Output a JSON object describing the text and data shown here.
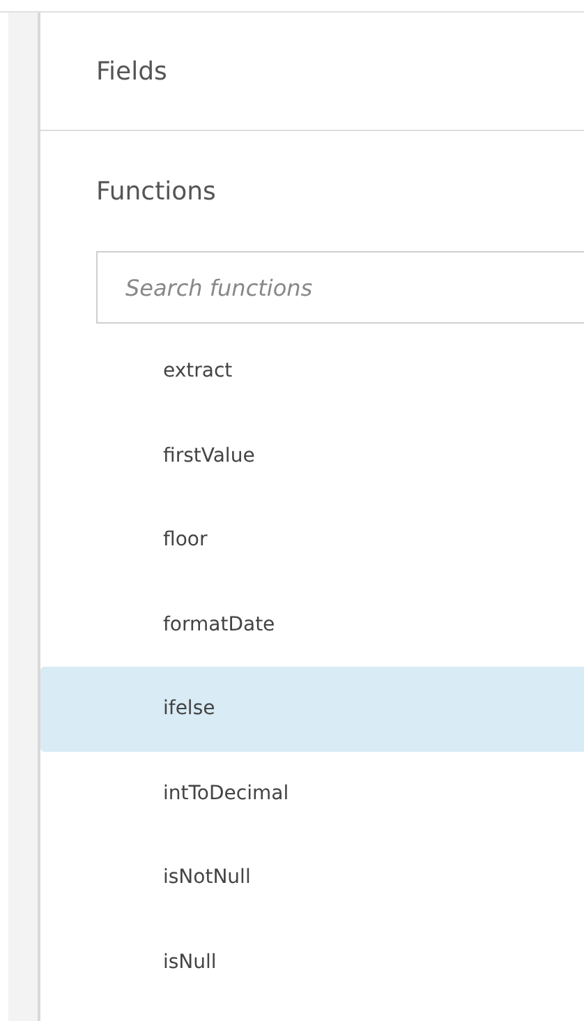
{
  "sections": [
    {
      "title": "Fields"
    },
    {
      "title": "Functions"
    }
  ],
  "search": {
    "placeholder": "Search functions"
  },
  "functions": [
    {
      "label": "extract",
      "selected": false
    },
    {
      "label": "firstValue",
      "selected": false
    },
    {
      "label": "floor",
      "selected": false
    },
    {
      "label": "formatDate",
      "selected": false
    },
    {
      "label": "ifelse",
      "selected": true
    },
    {
      "label": "intToDecimal",
      "selected": false
    },
    {
      "label": "isNotNull",
      "selected": false
    },
    {
      "label": "isNull",
      "selected": false
    }
  ]
}
